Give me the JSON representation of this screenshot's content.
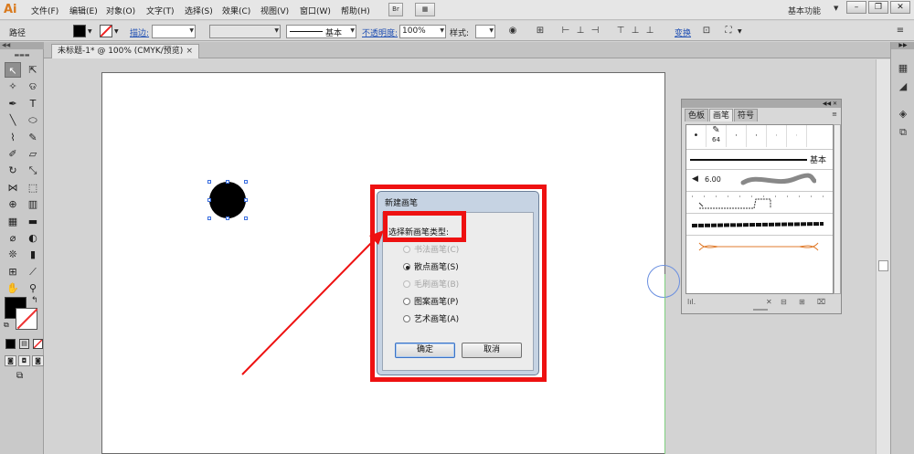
{
  "app": {
    "logo": "Ai"
  },
  "menu": [
    "文件(F)",
    "编辑(E)",
    "对象(O)",
    "文字(T)",
    "选择(S)",
    "效果(C)",
    "视图(V)",
    "窗口(W)",
    "帮助(H)"
  ],
  "menubar_icons": {
    "bridge": "Br",
    "arrange": "▦"
  },
  "workspace": {
    "label": "基本功能",
    "arrow": "▼"
  },
  "window_buttons": [
    "–",
    "❐",
    "✕"
  ],
  "control_bar": {
    "selection_label": "路径",
    "fill_color": "#000000",
    "stroke_label": "描边:",
    "stroke_weight": "",
    "stroke_profile": "",
    "brush_label": "基本",
    "opacity_label": "不透明度:",
    "opacity_value": "100%",
    "style_label": "样式:",
    "transform_label": "变换"
  },
  "document_tab": {
    "title": "未标题-1* @ 100% (CMYK/预览)",
    "close": "×"
  },
  "tools": [
    {
      "name": "selection-tool",
      "glyph": "↖"
    },
    {
      "name": "direct-selection-tool",
      "glyph": "⇱"
    },
    {
      "name": "magic-wand-tool",
      "glyph": "✧"
    },
    {
      "name": "lasso-tool",
      "glyph": "ଡ"
    },
    {
      "name": "pen-tool",
      "glyph": "✒"
    },
    {
      "name": "type-tool",
      "glyph": "T"
    },
    {
      "name": "line-tool",
      "glyph": "╲"
    },
    {
      "name": "ellipse-tool",
      "glyph": "⬭"
    },
    {
      "name": "paintbrush-tool",
      "glyph": "⌇"
    },
    {
      "name": "pencil-tool",
      "glyph": "✎"
    },
    {
      "name": "blob-brush-tool",
      "glyph": "✐"
    },
    {
      "name": "eraser-tool",
      "glyph": "▱"
    },
    {
      "name": "rotate-tool",
      "glyph": "↻"
    },
    {
      "name": "scale-tool",
      "glyph": "⤡"
    },
    {
      "name": "width-tool",
      "glyph": "⋈"
    },
    {
      "name": "free-transform-tool",
      "glyph": "⬚"
    },
    {
      "name": "shape-builder-tool",
      "glyph": "⊕"
    },
    {
      "name": "perspective-grid-tool",
      "glyph": "▥"
    },
    {
      "name": "mesh-tool",
      "glyph": "▦"
    },
    {
      "name": "gradient-tool",
      "glyph": "▬"
    },
    {
      "name": "eyedropper-tool",
      "glyph": "⌀"
    },
    {
      "name": "blend-tool",
      "glyph": "◐"
    },
    {
      "name": "symbol-sprayer-tool",
      "glyph": "❊"
    },
    {
      "name": "column-graph-tool",
      "glyph": "▮"
    },
    {
      "name": "artboard-tool",
      "glyph": "⊞"
    },
    {
      "name": "slice-tool",
      "glyph": "⟋"
    },
    {
      "name": "hand-tool",
      "glyph": "✋"
    },
    {
      "name": "zoom-tool",
      "glyph": "⚲"
    }
  ],
  "colors": {
    "fill": "#000000",
    "stroke": "none",
    "accent_red": "#ee1111"
  },
  "brush_panel": {
    "tabs": [
      "色板",
      "画笔",
      "符号"
    ],
    "active_tab": "画笔",
    "menu_glyph": "≡",
    "dot_sizes": [
      "•",
      "64",
      "·",
      "·",
      "·",
      "·"
    ],
    "basic_label": "基本",
    "scatter_value": "6.00",
    "footer_icons": [
      "lib",
      "✕",
      "⧉",
      "⊞",
      "🗑"
    ]
  },
  "dialog": {
    "title": "新建画笔",
    "prompt": "选择新画笔类型:",
    "options": [
      {
        "label": "书法画笔(C)",
        "enabled": false,
        "checked": false
      },
      {
        "label": "散点画笔(S)",
        "enabled": true,
        "checked": true
      },
      {
        "label": "毛刷画笔(B)",
        "enabled": false,
        "checked": false
      },
      {
        "label": "图案画笔(P)",
        "enabled": true,
        "checked": false
      },
      {
        "label": "艺术画笔(A)",
        "enabled": true,
        "checked": false
      }
    ],
    "ok_label": "确定",
    "cancel_label": "取消"
  },
  "right_dock_icons": [
    "color-icon",
    "color-guide-icon",
    "brush-icon",
    "layers-icon",
    "artboards-icon"
  ]
}
